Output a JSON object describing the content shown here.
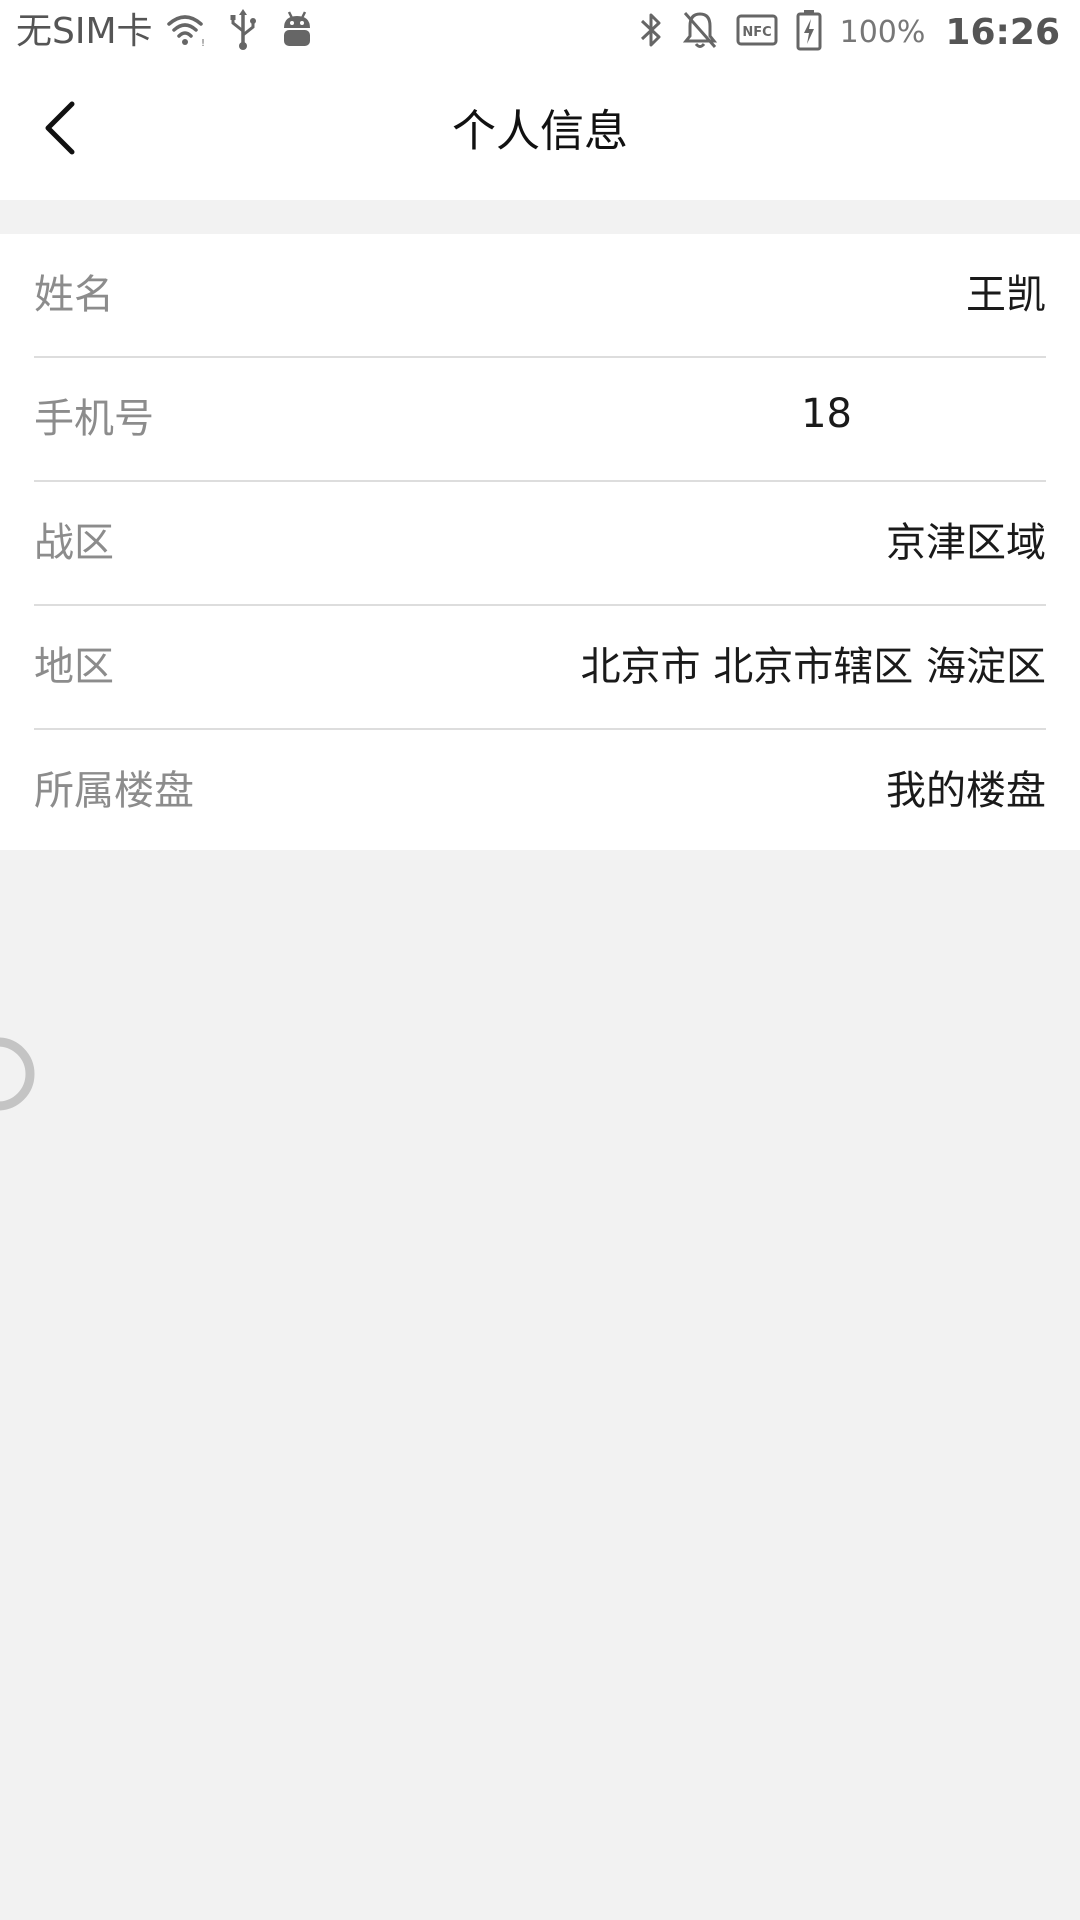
{
  "status_bar": {
    "carrier": "无SIM卡",
    "battery_percent": "100%",
    "time": "16:26",
    "icons_left": [
      "wifi-icon",
      "usb-icon",
      "android-debug-icon"
    ],
    "icons_right": [
      "bluetooth-icon",
      "notifications-off-icon",
      "nfc-icon",
      "battery-charging-icon"
    ]
  },
  "nav": {
    "title": "个人信息",
    "back_icon": "chevron-left-icon"
  },
  "profile": {
    "rows": [
      {
        "label": "姓名",
        "value": "王凯"
      },
      {
        "label": "手机号",
        "value": "18"
      },
      {
        "label": "战区",
        "value": "京津区域"
      },
      {
        "label": "地区",
        "value": "北京市 北京市辖区 海淀区"
      },
      {
        "label": "所属楼盘",
        "value": "我的楼盘"
      }
    ]
  },
  "colors": {
    "page_background": "#f2f2f2",
    "card_background": "#ffffff",
    "label_text": "#8c8c8c",
    "value_text": "#1a1a1a",
    "divider": "#dddddd"
  }
}
